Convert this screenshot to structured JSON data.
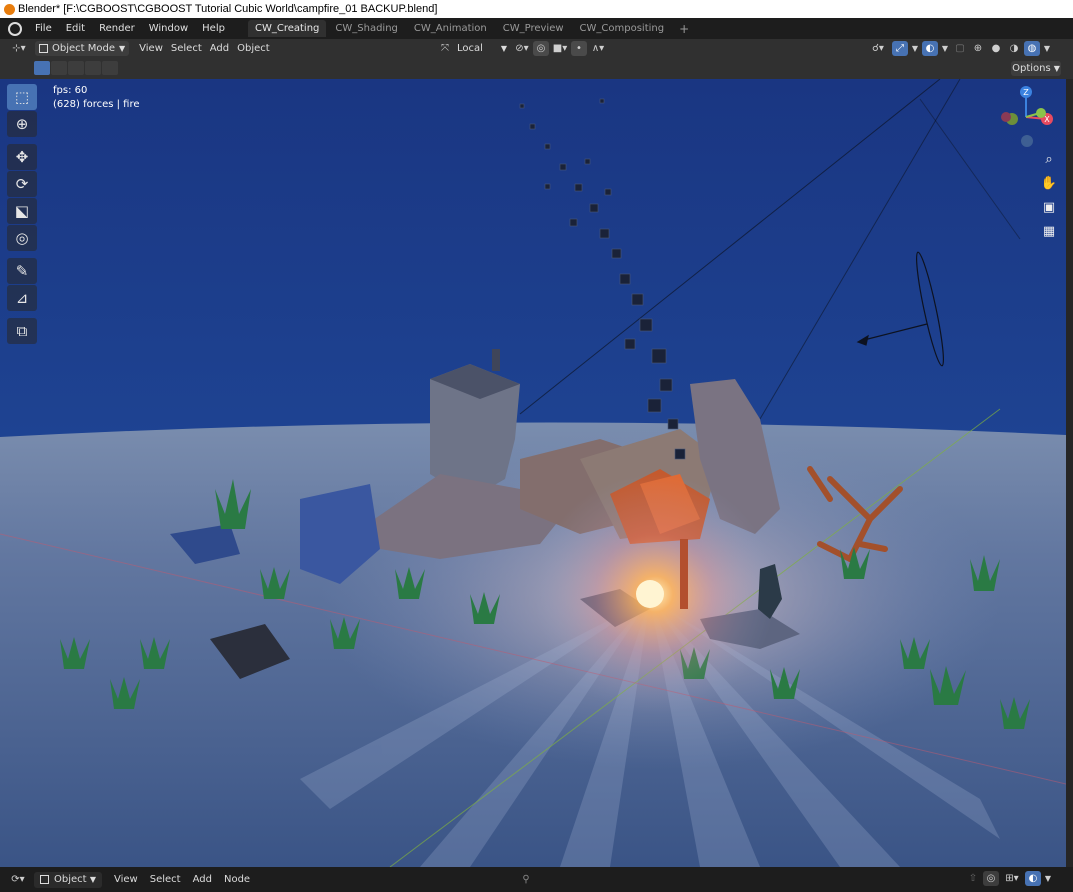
{
  "window": {
    "title": "Blender* [F:\\CGBOOST\\CGBOOST Tutorial Cubic World\\campfire_01 BACKUP.blend]"
  },
  "menu": {
    "items": [
      "File",
      "Edit",
      "Render",
      "Window",
      "Help"
    ]
  },
  "workspaces": {
    "tabs": [
      "CW_Creating",
      "CW_Shading",
      "CW_Animation",
      "CW_Preview",
      "CW_Compositing"
    ],
    "active": "CW_Creating",
    "add_label": "+"
  },
  "header": {
    "mode": "Object Mode",
    "menus": [
      "View",
      "Select",
      "Add",
      "Object"
    ],
    "transform_orientation": "Local",
    "options_label": "Options"
  },
  "viewport": {
    "fps_text": "fps: 60",
    "object_text": "(628) forces | fire",
    "gizmo_axes": {
      "z": "Z",
      "x": "X"
    }
  },
  "footer": {
    "editor_mode": "Object",
    "menus": [
      "View",
      "Select",
      "Add",
      "Node"
    ]
  },
  "colors": {
    "accent": "#4772b3",
    "sky": "#1b3c88",
    "ground": "#3f5a8a",
    "fire": "#ffb35a",
    "axis_x": "#e84a5f",
    "axis_y": "#8bc34a",
    "axis_z": "#3b82e0"
  },
  "icons": {
    "tools": [
      "select-box-icon",
      "cursor-icon",
      "move-icon",
      "rotate-icon",
      "scale-icon",
      "transform-icon",
      "annotate-icon",
      "measure-icon",
      "add-cube-icon"
    ],
    "nav": [
      "zoom-icon",
      "pan-hand-icon",
      "camera-icon",
      "grid-view-icon"
    ]
  }
}
